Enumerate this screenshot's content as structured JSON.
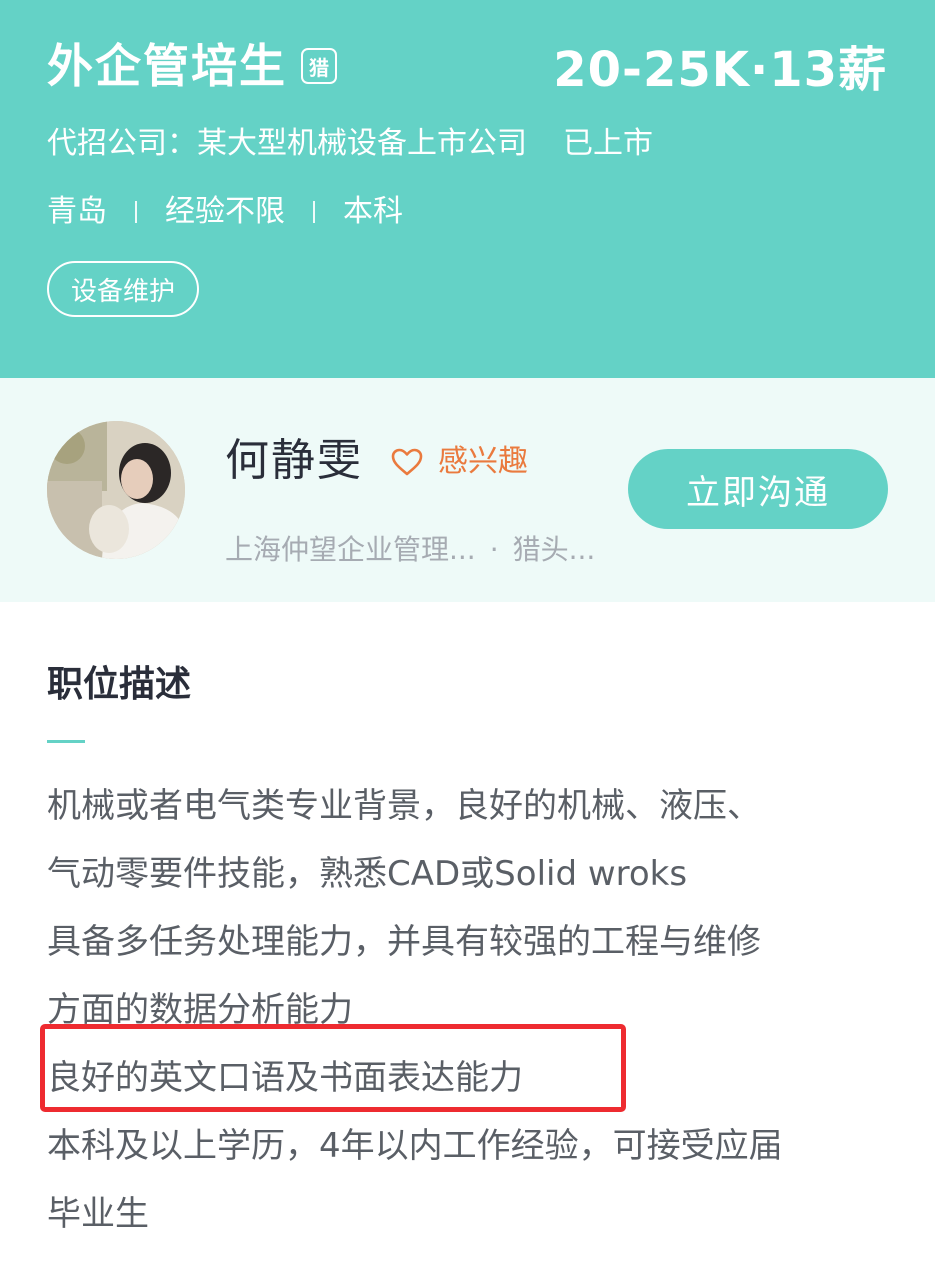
{
  "job": {
    "title": "外企管培生",
    "hunter_tag": "猎",
    "salary": "20-25K·13薪",
    "company": "代招公司：某大型机械设备上市公司",
    "listed_status": "已上市",
    "city": "青岛",
    "experience": "经验不限",
    "education": "本科",
    "tag": "设备维护"
  },
  "recruiter": {
    "name": "何静雯",
    "interest_label": "感兴趣",
    "company": "上海仲望企业管理...",
    "separator": "·",
    "role": "猎头...",
    "chat_button": "立即沟通"
  },
  "description": {
    "title": "职位描述",
    "lines": [
      "机械或者电气类专业背景，良好的机械、液压、",
      "气动零要件技能，熟悉CAD或Solid wroks",
      "具备多任务处理能力，并具有较强的工程与维修",
      "方面的数据分析能力",
      "良好的英文口语及书面表达能力",
      "本科及以上学历，4年以内工作经验，可接受应届",
      "毕业生"
    ]
  },
  "colors": {
    "accent": "#64d2c6",
    "interest": "#ea7a3e",
    "highlight": "#ee2b30"
  }
}
